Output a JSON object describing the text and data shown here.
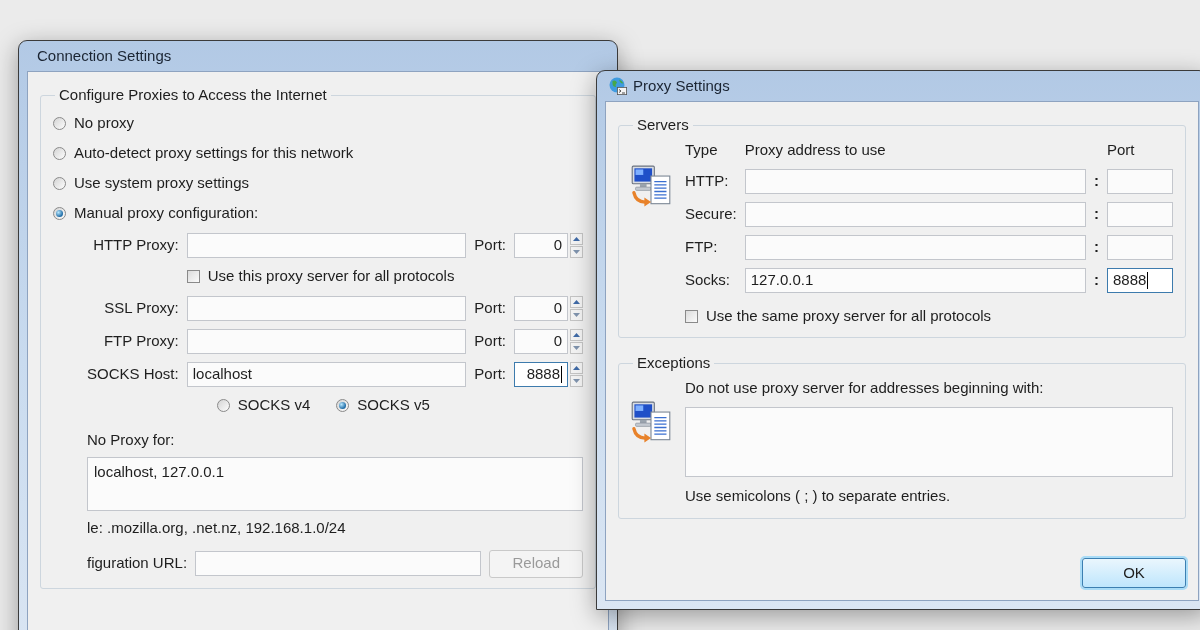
{
  "connection_settings": {
    "title": "Connection Settings",
    "group_title": "Configure Proxies to Access the Internet",
    "proxy_modes": [
      {
        "label": "No proxy",
        "selected": false
      },
      {
        "label": "Auto-detect proxy settings for this network",
        "selected": false
      },
      {
        "label": "Use system proxy settings",
        "selected": false
      },
      {
        "label": "Manual proxy configuration:",
        "selected": true
      }
    ],
    "manual_rows": [
      {
        "kind": "proxy",
        "label": "HTTP Proxy:",
        "port_label": "Port:",
        "port": "0",
        "focused": false
      },
      {
        "kind": "checkbox",
        "label": "Use this proxy server for all protocols",
        "checked": false
      },
      {
        "kind": "proxy",
        "label": "SSL Proxy:",
        "port_label": "Port:",
        "port": "0",
        "focused": false
      },
      {
        "kind": "proxy",
        "label": "FTP Proxy:",
        "port_label": "Port:",
        "port": "0",
        "focused": false
      },
      {
        "kind": "proxy",
        "label": "SOCKS Host:",
        "value": "localhost",
        "port_label": "Port:",
        "port": "8888",
        "focused": true
      },
      {
        "kind": "radios",
        "options": [
          {
            "label": "SOCKS v4",
            "selected": false
          },
          {
            "label": "SOCKS v5",
            "selected": true
          }
        ]
      }
    ],
    "no_proxy": {
      "label": "No Proxy for:",
      "value": "localhost, 127.0.0.1"
    },
    "example": "le: .mozilla.org, .net.nz, 192.168.1.0/24",
    "autoconfig": {
      "label": "figuration URL:",
      "button": {
        "label": "Reload",
        "disabled": true
      }
    }
  },
  "proxy_settings": {
    "title": "Proxy Settings",
    "servers": {
      "title": "Servers",
      "columns": [
        "Type",
        "Proxy address to use",
        "Port"
      ],
      "rows": [
        {
          "type": "HTTP:",
          "separator": ":",
          "focused": false
        },
        {
          "type": "Secure:",
          "separator": ":",
          "focused": false
        },
        {
          "type": "FTP:",
          "separator": ":",
          "focused": false
        },
        {
          "type": "Socks:",
          "address": "127.0.0.1",
          "separator": ":",
          "port": "8888",
          "focused": true
        }
      ],
      "same_for_all": {
        "label": "Use the same proxy server for all protocols",
        "checked": false
      }
    },
    "exceptions": {
      "title": "Exceptions",
      "label": "Do not use proxy server for addresses beginning with:",
      "note": "Use semicolons ( ; ) to separate entries."
    },
    "buttons": [
      {
        "label": "OK",
        "default": true
      }
    ]
  }
}
